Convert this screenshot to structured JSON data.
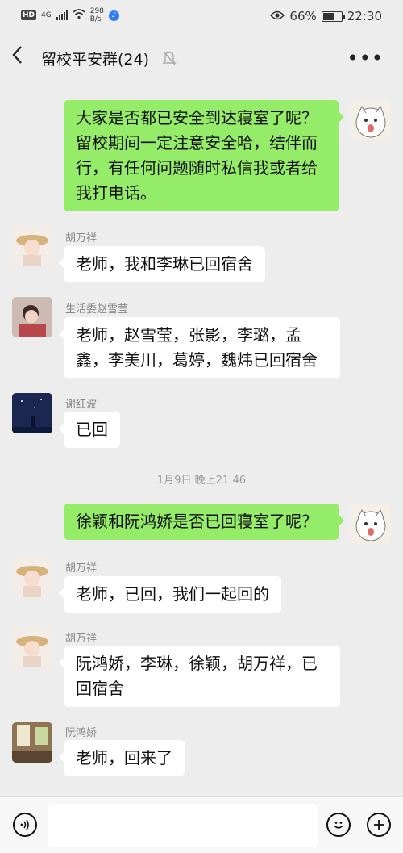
{
  "status_bar": {
    "hd": "HD",
    "network": "4G",
    "speed_value": "298",
    "speed_unit": "B/s",
    "battery": "66%",
    "time": "22:30"
  },
  "header": {
    "title": "留校平安群(24)"
  },
  "messages": [
    {
      "side": "out",
      "text": "大家是否都已安全到达寝室了呢？留校期间一定注意安全哈，结伴而行，有任何问题随时私信我或者给我打电话。"
    },
    {
      "side": "in",
      "sender": "胡万祥",
      "text": "老师，我和李琳已回宿舍"
    },
    {
      "side": "in",
      "sender": "生活委赵雪莹",
      "text": "老师，赵雪莹，张影，李璐，孟鑫，李美川，葛婷，魏炜已回宿舍"
    },
    {
      "side": "in",
      "sender": "谢红波",
      "text": "已回"
    },
    {
      "timestamp": "1月9日 晚上21:46"
    },
    {
      "side": "out",
      "text": "徐颖和阮鸿娇是否已回寝室了呢？"
    },
    {
      "side": "in",
      "sender": "胡万祥",
      "text": "老师，已回，我们一起回的"
    },
    {
      "side": "in",
      "sender": "胡万祥",
      "text": "阮鸿娇，李琳，徐颖，胡万祥，已回宿舍"
    },
    {
      "side": "in",
      "sender": "阮鸿娇",
      "text": "老师，回来了"
    }
  ],
  "input_bar": {
    "voice_icon": "voice-icon",
    "emoji_icon": "emoji-icon",
    "plus_icon": "plus-icon"
  },
  "colors": {
    "background": "#ededed",
    "outgoing_bubble": "#95ec69",
    "incoming_bubble": "#ffffff"
  }
}
